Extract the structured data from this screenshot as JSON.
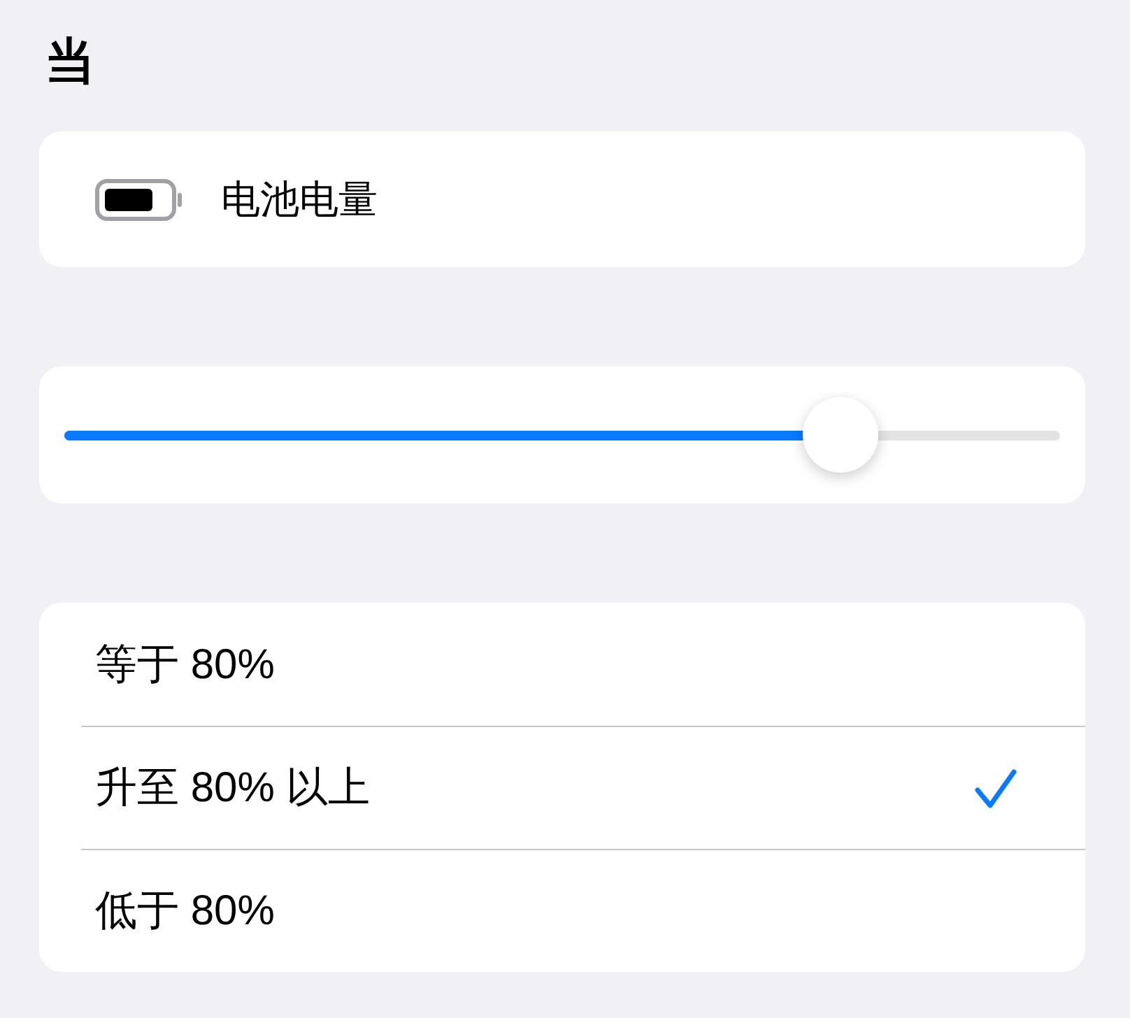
{
  "header": {
    "title": "当"
  },
  "source": {
    "label": "电池电量"
  },
  "slider": {
    "level": 0.78
  },
  "options": [
    {
      "label": "等于 80%",
      "selected": false
    },
    {
      "label": "升至 80% 以上",
      "selected": true
    },
    {
      "label": "低于 80%",
      "selected": false
    }
  ]
}
